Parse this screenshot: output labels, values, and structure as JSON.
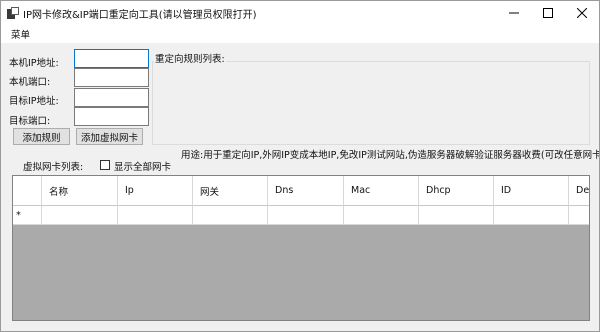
{
  "window": {
    "title": "IP网卡修改&IP端口重定向工具(请以管理员权限打开)",
    "controls": [
      "minimize",
      "maximize",
      "close"
    ]
  },
  "menu": {
    "items": [
      {
        "label": "菜单"
      }
    ]
  },
  "form": {
    "local_ip_label": "本机IP地址:",
    "local_port_label": "本机端口:",
    "target_ip_label": "目标IP地址:",
    "target_port_label": "目标端口:",
    "local_ip_value": "",
    "local_port_value": "",
    "target_ip_value": "",
    "target_port_value": "",
    "add_rule_button": "添加规则",
    "add_virtual_nic_button": "添加虚拟网卡"
  },
  "rules": {
    "title": "重定向规则列表:"
  },
  "usage_text": "用途:用于重定向IP,外网IP变成本地IP,免改IP测试网站,伪造服务器破解验证服务器收费(可改任意网卡)",
  "nic_list": {
    "label": "虚拟网卡列表:",
    "show_all_label": "显示全部网卡",
    "show_all_checked": false
  },
  "grid": {
    "columns": [
      "名称",
      "Ip",
      "网关",
      "Dns",
      "Mac",
      "Dhcp",
      "ID",
      "Des"
    ],
    "new_row_marker": "*",
    "empty_area_color": "#aaaaaa"
  }
}
